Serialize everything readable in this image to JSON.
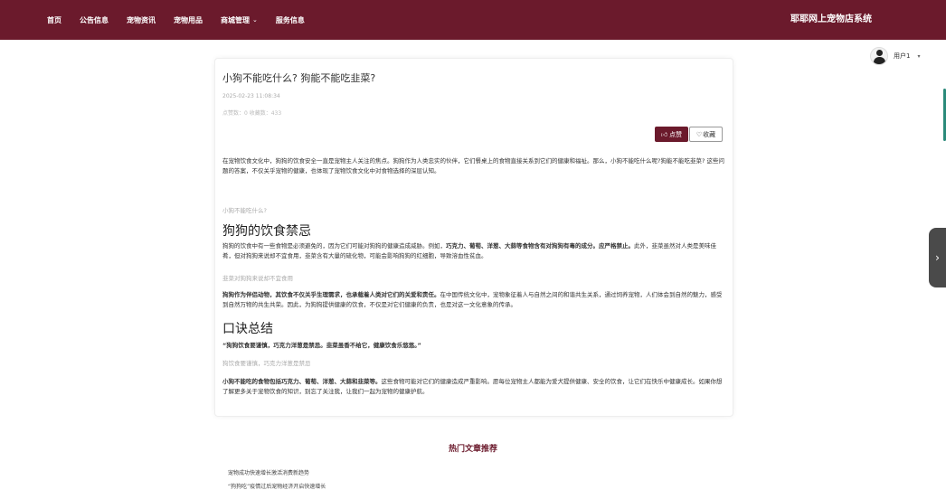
{
  "nav": {
    "items": [
      "首页",
      "公告信息",
      "宠物资讯",
      "宠物用品",
      "商城管理",
      "服务信息"
    ],
    "brand": "耶耶网上宠物店系统"
  },
  "user": {
    "name": "用户1"
  },
  "article": {
    "title": "小狗不能吃什么? 狗能不能吃韭菜?",
    "date": "2025-02-23 11:08:34",
    "meta": "点赞数：0   收藏数：433",
    "like_label": "点赞",
    "fav_label": "收藏",
    "intro": "在宠物饮食文化中，狗狗的饮食安全一直是宠物主人关注的焦点。狗狗作为人类忠实的伙伴，它们餐桌上的食物直接关系到它们的健康和福祉。那么，小狗不能吃什么呢?狗能不能吃韭菜? 这些问题的答案，不仅关乎宠物的健康，也体现了宠物饮食文化中对食物选择的深层认知。",
    "quote1": "小狗不能吃什么?",
    "heading1": "狗狗的饮食禁忌",
    "para1_normal": "狗狗的饮食中有一些食物是必须避免的，因为它们可能对狗狗的健康造成威胁。例如，",
    "para1_bold": "巧克力、葡萄、洋葱、大蒜等食物含有对狗狗有毒的成分。应严格禁止。",
    "para1_rest": "此外，韭菜虽然对人类是美味佳肴，但对狗狗来说却不宜食用，韭菜含有大量的硫化物，可能会影响狗狗的红细胞，导致溶血性贫血。",
    "quote2": "韭菜对狗狗来说却不宜食用",
    "para2_bold": "狗狗作为伴侣动物，其饮食不仅关乎生理需求，也承载着人类对它们的关爱和责任。",
    "para2_rest": "在中国传统文化中，宠物象征着人与自然之间的和谐共生关系，通过饲养宠物，人们体会到自然的魅力，感受到自然万物的共生共荣。因此，为狗狗提供健康的饮食，不仅是对它们健康的负责，也是对这一文化意象的传承。",
    "heading2": "口诀总结",
    "motto": "“狗狗饮食要谨慎，巧克力洋葱是禁忌。韭菜虽香不给它，健康饮食乐悠悠。”",
    "quote3": "狗饮食要谨慎，巧克力洋葱是禁忌",
    "para3_bold": "小狗不能吃的食物包括巧克力、葡萄、洋葱、大蒜和韭菜等。",
    "para3_rest": "这些食物可能对它们的健康造成严重影响。愿每位宠物主人都能为爱犬提供健康、安全的饮食，让它们在快乐中健康成长。如果你想了解更多关于宠物饮食的知识，别忘了关注我，让我们一起为宠物的健康护航。"
  },
  "hot": {
    "title": "热门文章推荐",
    "items": [
      "宠物成功快速增长激活消费新趋势",
      "“狗狗吃”疫情过后宠物经济开启快速增长"
    ]
  }
}
